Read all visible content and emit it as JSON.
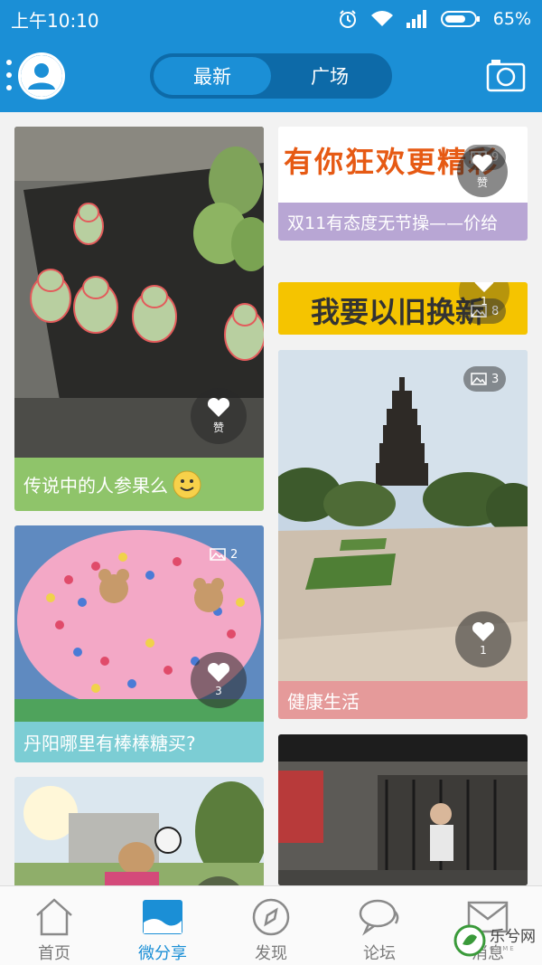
{
  "status_bar": {
    "time": "上午10:10",
    "battery": "65%"
  },
  "header": {
    "tabs": [
      {
        "label": "最新",
        "active": true
      },
      {
        "label": "广场",
        "active": false
      }
    ]
  },
  "feed": {
    "left": [
      {
        "caption": "传说中的人参果么",
        "like_label": "赞",
        "caption_color": "#8fc46a"
      },
      {
        "caption": "丹阳哪里有棒棒糖买?",
        "photo_count": "2",
        "like_count": "3",
        "caption_color": "#7ccdd4"
      },
      {
        "caption": ""
      }
    ],
    "right": [
      {
        "caption": "双11有态度无节操——价给",
        "banner_text": "有你狂欢更精彩",
        "photo_count": "9",
        "like_label": "赞",
        "caption_color": "#b8a6d4"
      },
      {
        "banner_text": "我要以旧换新",
        "photo_count": "8",
        "like_count": "1"
      },
      {
        "caption": "健康生活",
        "photo_count": "3",
        "like_count": "1",
        "caption_color": "#e59a9a"
      },
      {
        "caption": ""
      }
    ]
  },
  "bottom_nav": [
    {
      "label": "首页",
      "icon": "home-icon",
      "active": false
    },
    {
      "label": "微分享",
      "icon": "image-share-icon",
      "active": true
    },
    {
      "label": "发现",
      "icon": "compass-icon",
      "active": false
    },
    {
      "label": "论坛",
      "icon": "chat-bubbles-icon",
      "active": false
    },
    {
      "label": "消息",
      "icon": "mail-icon",
      "active": false
    }
  ],
  "watermark": {
    "text": "乐兮网",
    "sub": "GAME"
  },
  "colors": {
    "primary": "#1b8fd6",
    "primary_dark": "#0d6aa8"
  }
}
